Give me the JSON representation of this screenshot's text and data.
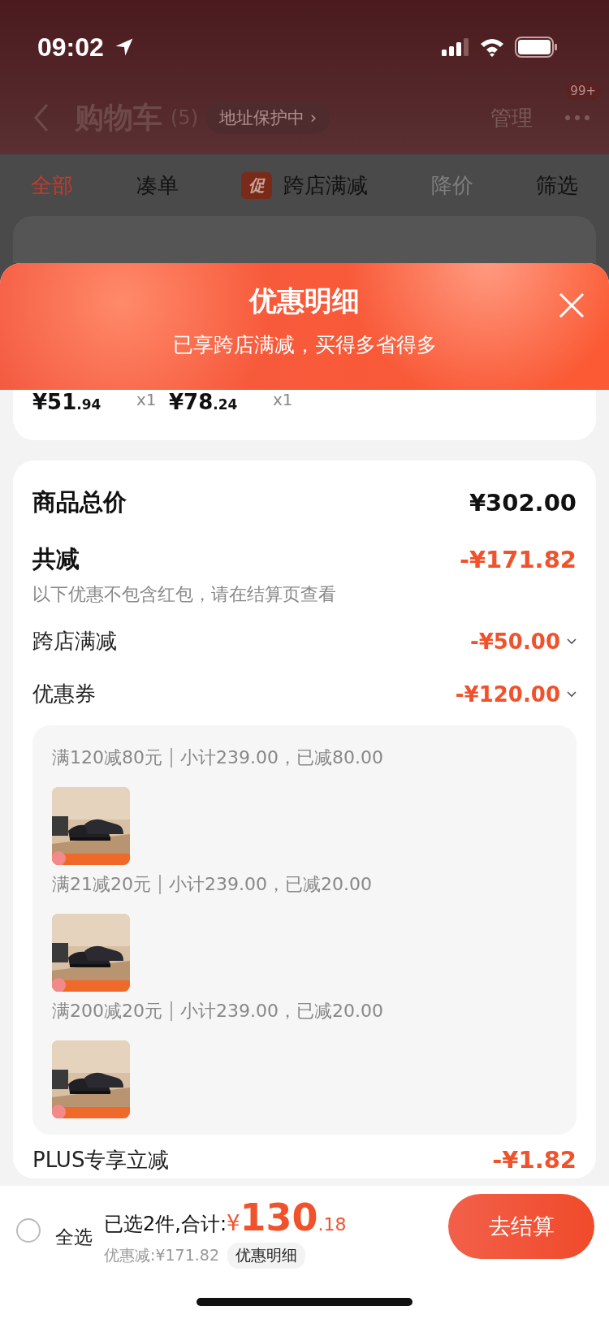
{
  "status_bar": {
    "time": "09:02"
  },
  "header": {
    "title": "购物车",
    "count": "(5)",
    "address_badge": "地址保护中",
    "address_chevron": "›",
    "manage": "管理",
    "badge": "99+"
  },
  "filter_tabs": [
    {
      "label": "全部",
      "selected": true,
      "disabled": false
    },
    {
      "label": "凑单",
      "selected": false,
      "disabled": false
    },
    {
      "label": "跨店满减",
      "selected": false,
      "disabled": false,
      "badge": "促"
    },
    {
      "label": "降价",
      "selected": false,
      "disabled": true
    },
    {
      "label": "筛选",
      "selected": false,
      "disabled": false
    }
  ],
  "sheet": {
    "title": "优惠明细",
    "subtitle": "已享跨店满减，买得多省得多"
  },
  "items": [
    {
      "price_int": "¥51",
      "price_dec": ".94",
      "qty": "x1"
    },
    {
      "price_int": "¥78",
      "price_dec": ".24",
      "qty": "x1"
    }
  ],
  "summary": {
    "total_label": "商品总价",
    "total_value": "¥302.00",
    "reduction_label": "共减",
    "reduction_value": "-¥171.82",
    "note": "以下优惠不包含红包，请在结算页查看"
  },
  "discounts": [
    {
      "label": "跨店满减",
      "value": "-¥50.00"
    },
    {
      "label": "优惠券",
      "value": "-¥120.00"
    }
  ],
  "coupon_groups": [
    {
      "rule": "满120减80元",
      "detail": "小计239.00，已减80.00",
      "kind": "picture"
    },
    {
      "rule": "满21减20元",
      "detail": "小计239.00，已减20.00",
      "kind": "picture"
    },
    {
      "rule": "满200减20元",
      "detail": "小计239.00，已减20.00",
      "kind": "picture"
    }
  ],
  "plus": {
    "label": "PLUS专享立减",
    "value": "-¥1.82"
  },
  "bottom_bar": {
    "select_all": {
      "label": "全选",
      "checked": false
    },
    "selected_text": "已选2件,合计:",
    "currency": "¥",
    "total_int": "130",
    "total_dec": ".18",
    "saving": "优惠减:¥171.82",
    "detail_button": "优惠明细",
    "checkout": "去结算"
  }
}
